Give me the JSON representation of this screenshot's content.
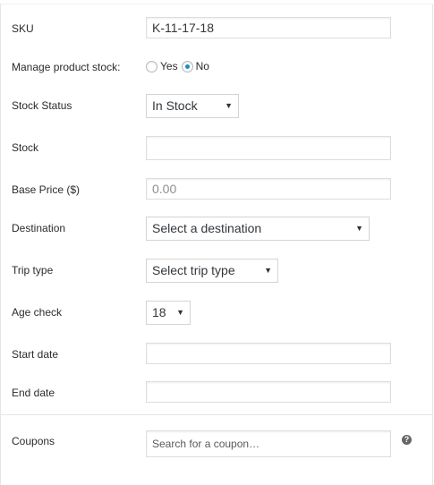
{
  "fields": {
    "sku": {
      "label": "SKU",
      "value": "K-11-17-18"
    },
    "manage_stock": {
      "label": "Manage product stock:",
      "yes_label": "Yes",
      "no_label": "No",
      "selected": "No"
    },
    "stock_status": {
      "label": "Stock Status",
      "value": "In Stock"
    },
    "stock": {
      "label": "Stock",
      "value": ""
    },
    "base_price": {
      "label": "Base Price ($)",
      "placeholder": "0.00"
    },
    "destination": {
      "label": "Destination",
      "value": "Select a destination"
    },
    "trip_type": {
      "label": "Trip type",
      "value": "Select trip type"
    },
    "age_check": {
      "label": "Age check",
      "value": "18"
    },
    "start_date": {
      "label": "Start date",
      "value": ""
    },
    "end_date": {
      "label": "End date",
      "value": ""
    },
    "coupons": {
      "label": "Coupons",
      "placeholder": "Search for a coupon…"
    }
  },
  "icons": {
    "dropdown": "chevron-down-icon",
    "help": "help-icon"
  },
  "help_glyph": "?",
  "colors": {
    "radio_selected": "#1e8cbe",
    "border": "#dddddd",
    "help_icon": "#666666"
  }
}
